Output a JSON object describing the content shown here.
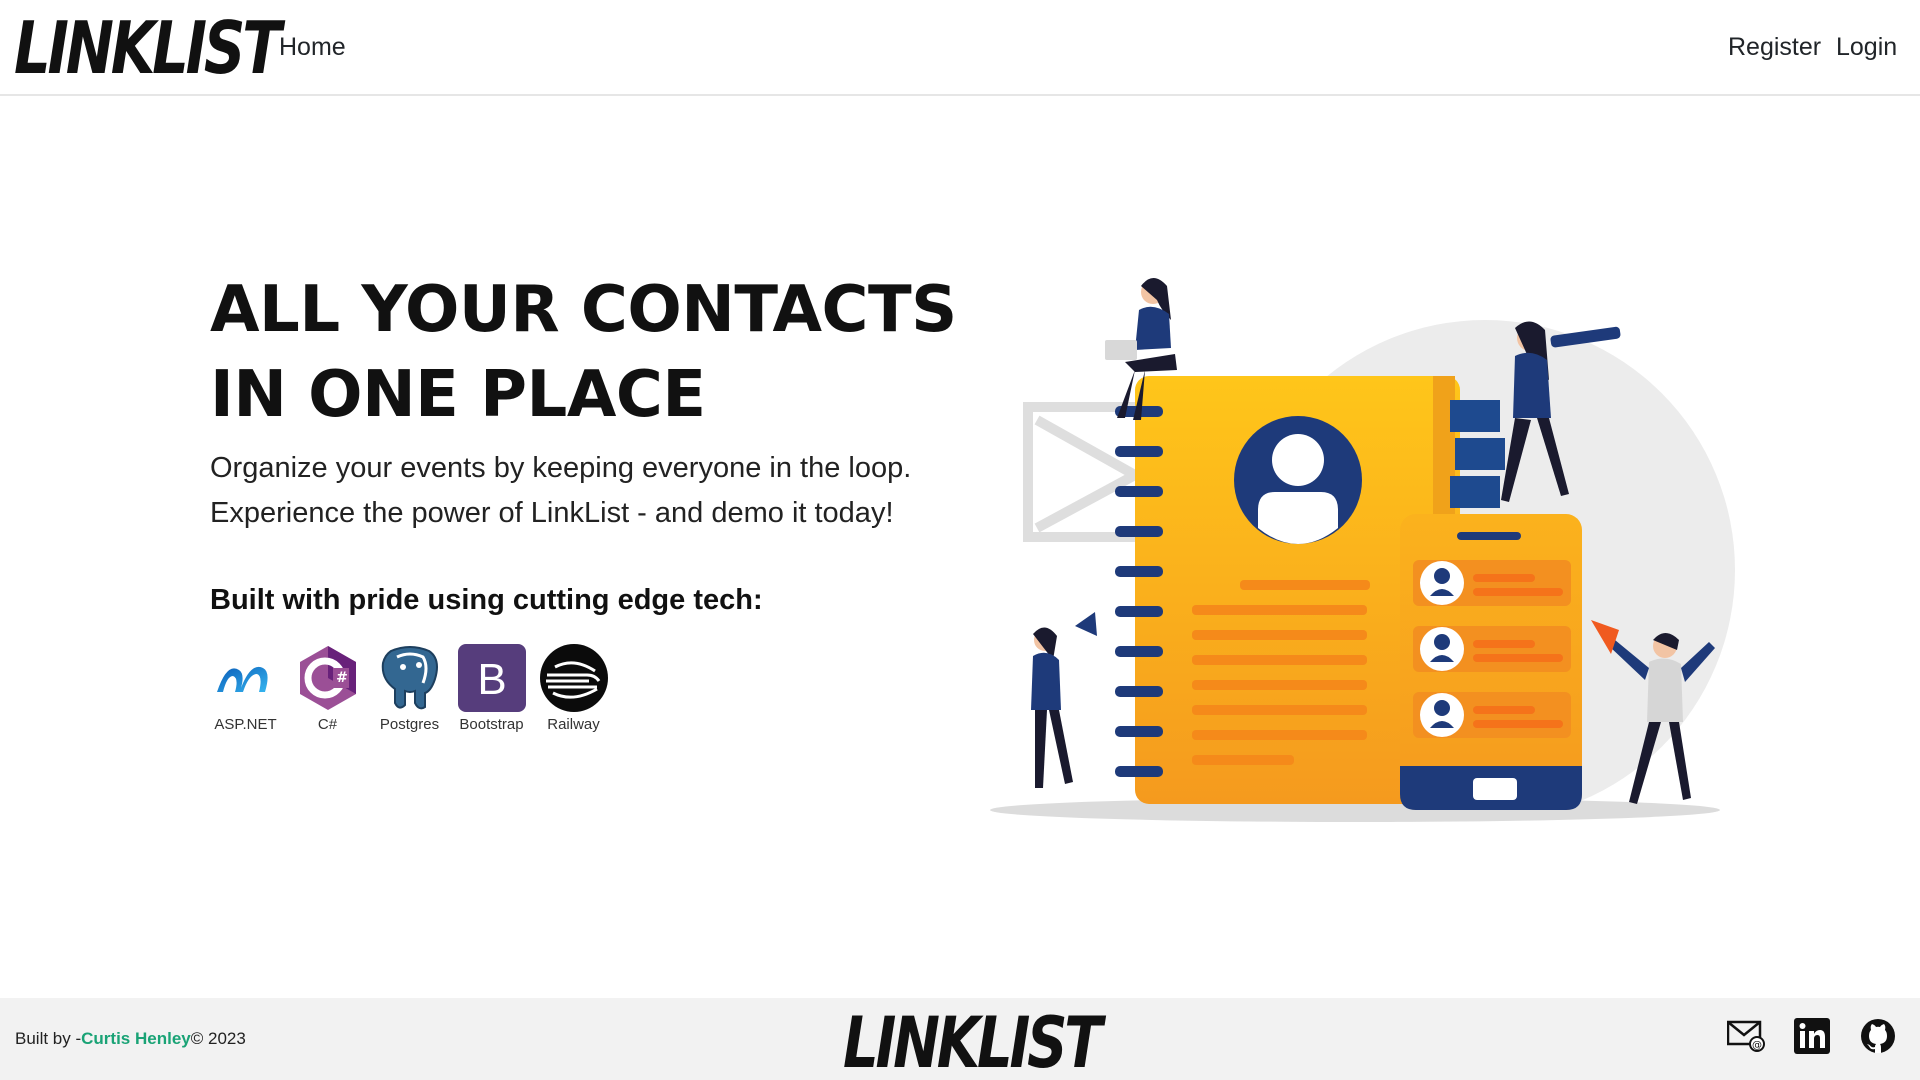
{
  "navbar": {
    "brand": "LINKLIST",
    "home_label": "Home",
    "register_label": "Register",
    "login_label": "Login"
  },
  "hero": {
    "title": "ALL YOUR CONTACTS IN ONE PLACE",
    "subtitle": "Organize your events by keeping everyone in the loop. Experience the power of LinkList - and demo it today!",
    "tech_heading": "Built with pride using cutting edge tech:",
    "tech": [
      {
        "label": "ASP.NET",
        "icon": "aspnet-icon"
      },
      {
        "label": "C#",
        "icon": "csharp-icon"
      },
      {
        "label": "Postgres",
        "icon": "postgres-icon"
      },
      {
        "label": "Bootstrap",
        "icon": "bootstrap-icon"
      },
      {
        "label": "Railway",
        "icon": "railway-icon"
      }
    ]
  },
  "footer": {
    "built_by": "Built by -",
    "author": "Curtis Henley",
    "copyright": "© 2023",
    "brand": "LINKLIST",
    "icons": [
      "email-icon",
      "linkedin-icon",
      "github-icon"
    ]
  },
  "colors": {
    "accent_green": "#1aa376",
    "book_orange": "#f7a81b",
    "navy": "#1e3a7a",
    "csharp_purple": "#9b4f96",
    "bootstrap_purple": "#563d7c"
  }
}
